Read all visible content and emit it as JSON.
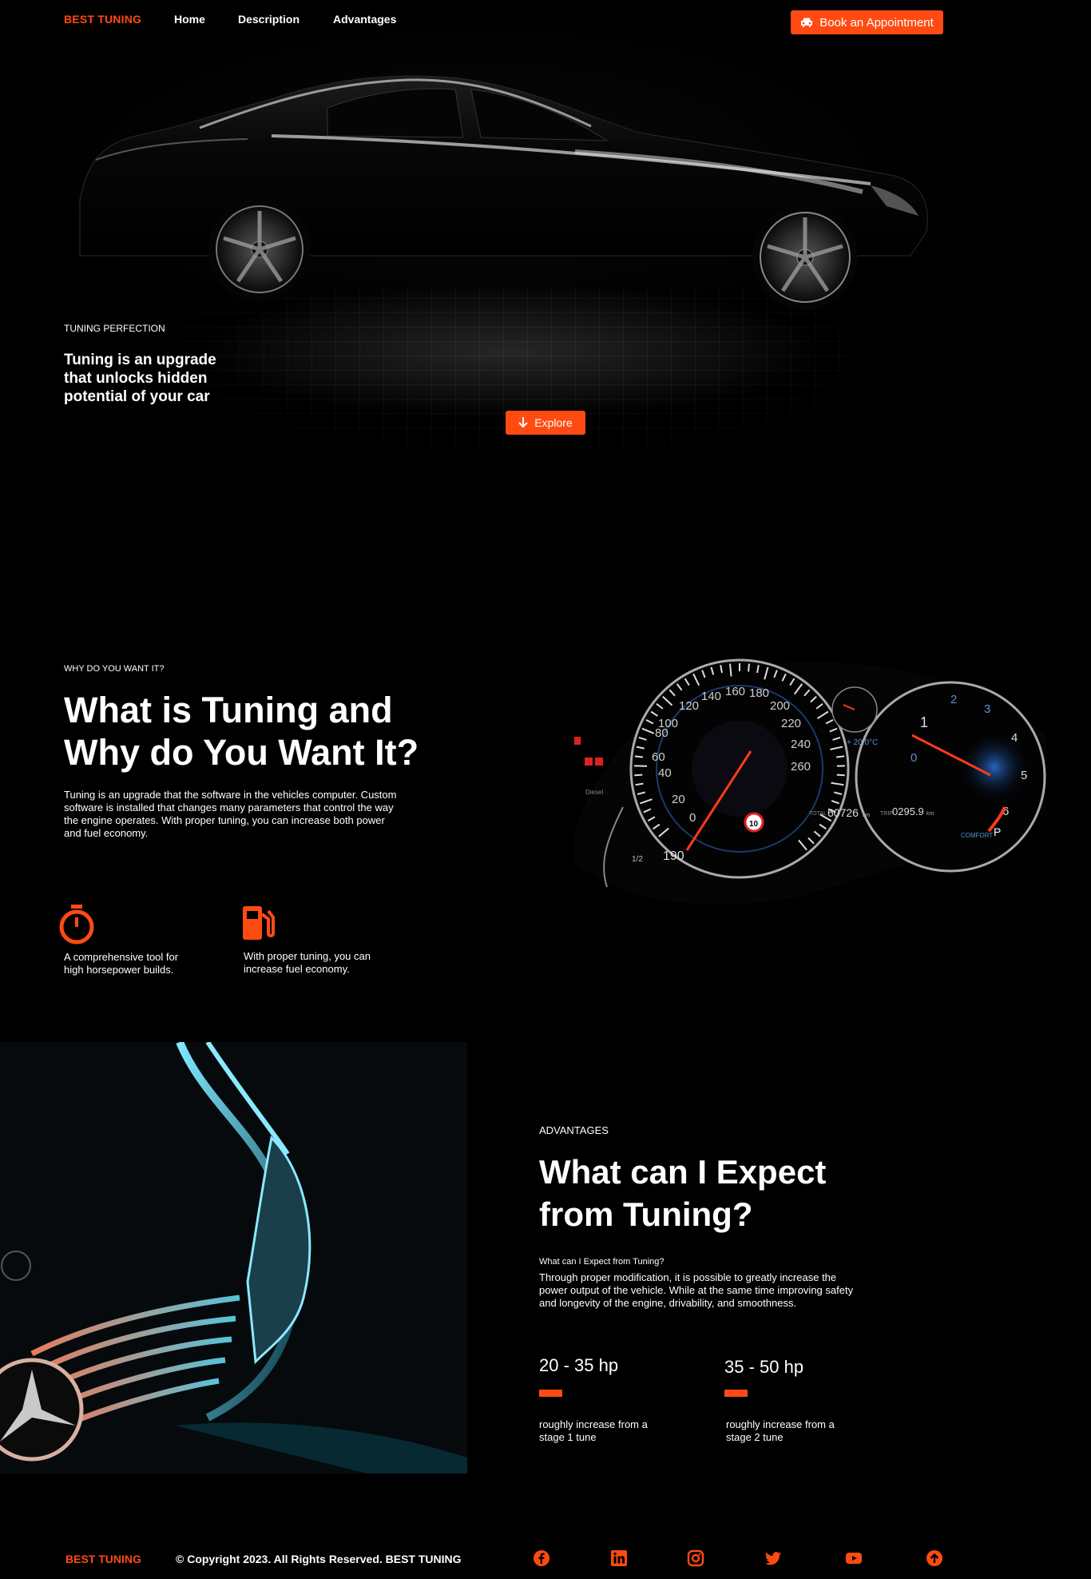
{
  "nav": {
    "brand": "BEST TUNING",
    "links": [
      "Home",
      "Description",
      "Advantages"
    ],
    "book_label": "Book an Appointment"
  },
  "hero": {
    "eyebrow": "TUNING PERFECTION",
    "title": "Tuning is an upgrade that unlocks hidden potential of your car",
    "explore_label": "Explore"
  },
  "why": {
    "eyebrow": "WHY DO YOU WANT IT?",
    "title": "What is Tuning and Why do You Want It?",
    "body": "Tuning is an upgrade that the software in the vehicles computer. Custom software is installed that changes many parameters that control the way the engine operates. With proper tuning, you can increase both power and fuel economy.",
    "features": [
      {
        "icon": "stopwatch-icon",
        "text": "A comprehensive tool for high horsepower builds."
      },
      {
        "icon": "fuel-pump-icon",
        "text": "With proper tuning, you can increase fuel economy."
      }
    ],
    "dashboard": {
      "speed_ticks": [
        "0",
        "20",
        "40",
        "60",
        "80",
        "100",
        "120",
        "140",
        "160",
        "180",
        "200",
        "220",
        "240",
        "260"
      ],
      "rpm_ticks": [
        "0",
        "1",
        "2",
        "3",
        "4",
        "5",
        "6"
      ],
      "total": "60726",
      "trip": "0295.9",
      "unit_km": "km",
      "speed_limit": "10",
      "range": "190",
      "temp": "+ 20.0°C",
      "mode": "COMFORT",
      "gear": "P",
      "fuel_label": "Diesel",
      "half": "1/2",
      "total_label": "TOTAL",
      "trip_label": "TRIP"
    }
  },
  "advantages": {
    "eyebrow": "ADVANTAGES",
    "title": "What can I Expect from Tuning?",
    "subtitle": "What can I Expect from Tuning?",
    "body": "Through proper modification, it is possible to greatly increase the power output of the vehicle. While at the same time improving safety and longevity of the engine, drivability, and smoothness.",
    "stats": [
      {
        "value": "20 - 35 hp",
        "desc": "roughly increase from a stage 1 tune"
      },
      {
        "value": "35 - 50 hp",
        "desc": "roughly increase from a stage 2 tune"
      }
    ]
  },
  "footer": {
    "brand": "BEST TUNING",
    "copyright": "© Copyright 2023. All Rights Reserved. BEST TUNING",
    "social": [
      "facebook-icon",
      "linkedin-icon",
      "instagram-icon",
      "twitter-icon",
      "youtube-icon",
      "arrow-up-circle-icon"
    ]
  },
  "colors": {
    "accent": "#ff4b12",
    "background": "#000000",
    "text": "#ffffff"
  }
}
